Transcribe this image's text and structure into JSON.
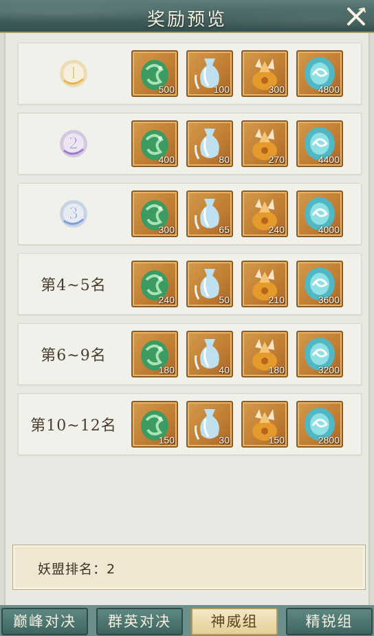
{
  "header": {
    "title": "奖励预览"
  },
  "rewards": [
    {
      "rank": "1",
      "rank_label": "",
      "items": [
        "500",
        "100",
        "300",
        "4800"
      ]
    },
    {
      "rank": "2",
      "rank_label": "",
      "items": [
        "400",
        "80",
        "270",
        "4400"
      ]
    },
    {
      "rank": "3",
      "rank_label": "",
      "items": [
        "300",
        "65",
        "240",
        "4000"
      ]
    },
    {
      "rank": "",
      "rank_label": "第4~5名",
      "items": [
        "240",
        "50",
        "210",
        "3600"
      ]
    },
    {
      "rank": "",
      "rank_label": "第6~9名",
      "items": [
        "180",
        "40",
        "180",
        "3200"
      ]
    },
    {
      "rank": "",
      "rank_label": "第10~12名",
      "items": [
        "150",
        "30",
        "150",
        "2800"
      ]
    }
  ],
  "item_icons": [
    "jade-dragon-icon",
    "water-gourd-icon",
    "fox-treasure-bag-icon",
    "blue-spirit-orb-icon"
  ],
  "medal_colors": [
    "#e8b54c",
    "#a07ad0",
    "#7f9fd8"
  ],
  "status": {
    "text": "妖盟排名：2"
  },
  "tabs": [
    {
      "label": "巅峰对决",
      "active": false
    },
    {
      "label": "群英对决",
      "active": false
    },
    {
      "label": "神威组",
      "active": true
    },
    {
      "label": "精锐组",
      "active": false
    }
  ]
}
